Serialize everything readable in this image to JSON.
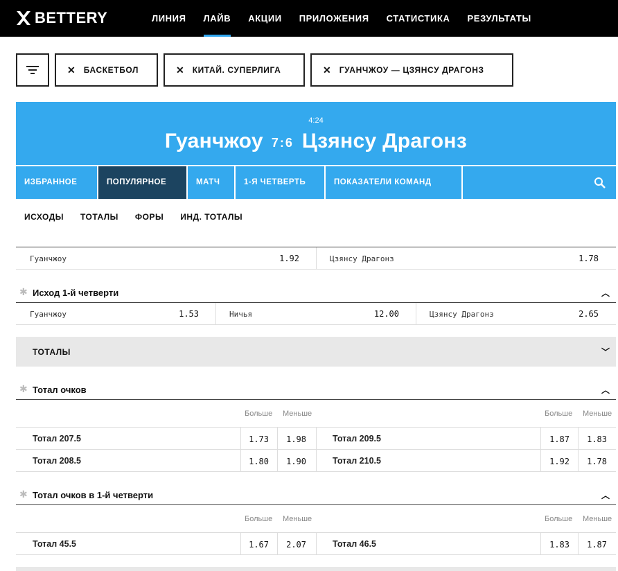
{
  "brand": {
    "name": "BETTERY"
  },
  "nav": [
    "ЛИНИЯ",
    "ЛАЙВ",
    "АКЦИИ",
    "ПРИЛОЖЕНИЯ",
    "СТАТИСТИКА",
    "РЕЗУЛЬТАТЫ"
  ],
  "filters": {
    "sport": "БАСКЕТБОЛ",
    "league": "КИТАЙ. СУПЕРЛИГА",
    "match": "ГУАНЧЖОУ — ЦЗЯНСУ ДРАГОНЗ"
  },
  "match": {
    "clock": "4:24",
    "home": "Гуанчжоу",
    "away": "Цзянсу Драгонз",
    "score": "7:6"
  },
  "market_tabs": [
    "ИЗБРАННОЕ",
    "ПОПУЛЯРНОЕ",
    "МАТЧ",
    "1-Я ЧЕТВЕРТЬ",
    "ПОКАЗАТЕЛИ КОМАНД"
  ],
  "sub_tabs": [
    "ИСХОДЫ",
    "ТОТАЛЫ",
    "ФОРЫ",
    "ИНД. ТОТАЛЫ"
  ],
  "winner": {
    "home": "Гуанчжоу",
    "home_odd": "1.92",
    "away": "Цзянсу Драгонз",
    "away_odd": "1.78"
  },
  "q1_outcome": {
    "title": "Исход 1-й четверти",
    "home": "Гуанчжоу",
    "home_odd": "1.53",
    "draw": "Ничья",
    "draw_odd": "12.00",
    "away": "Цзянсу Драгонз",
    "away_odd": "2.65"
  },
  "totals_band": "ТОТАЛЫ",
  "total_points": {
    "title": "Тотал очков",
    "over": "Больше",
    "under": "Меньше",
    "rows": [
      {
        "left": "Тотал 207.5",
        "lo": "1.73",
        "lu": "1.98",
        "right": "Тотал 209.5",
        "ro": "1.87",
        "ru": "1.83"
      },
      {
        "left": "Тотал 208.5",
        "lo": "1.80",
        "lu": "1.90",
        "right": "Тотал 210.5",
        "ro": "1.92",
        "ru": "1.78"
      }
    ]
  },
  "total_q1": {
    "title": "Тотал очков в 1-й четверти",
    "over": "Больше",
    "under": "Меньше",
    "rows": [
      {
        "left": "Тотал 45.5",
        "lo": "1.67",
        "lu": "2.07",
        "right": "Тотал 46.5",
        "ro": "1.83",
        "ru": "1.87"
      }
    ]
  },
  "colors": {
    "accent": "#34a9ee",
    "active_tab": "#1c4460",
    "header": "#000000"
  }
}
